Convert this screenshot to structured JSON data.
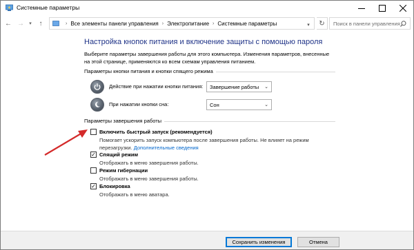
{
  "window": {
    "title": "Системные параметры"
  },
  "address": {
    "crumbs": [
      "Все элементы панели управления",
      "Электропитание",
      "Системные параметры"
    ],
    "search_placeholder": "Поиск в панели управления"
  },
  "main": {
    "heading": "Настройка кнопок питания и включение защиты с помощью пароля",
    "description": "Выберите параметры завершения работы для этого компьютера. Изменения параметров, внесенные на этой странице, применяются ко всем схемам управления питанием."
  },
  "power_buttons": {
    "group_label": "Параметры кнопки питания и кнопки спящего режима",
    "rows": [
      {
        "label": "Действие при нажатии кнопки питания:",
        "value": "Завершение работы"
      },
      {
        "label": "При нажатии кнопки сна:",
        "value": "Сон"
      }
    ]
  },
  "shutdown": {
    "group_label": "Параметры завершения работы",
    "options": [
      {
        "label": "Включить быстрый запуск (рекомендуется)",
        "checked": false,
        "desc": "Помогает ускорить запуск компьютера после завершения работы. Не влияет на режим перезагрузки.",
        "link": "Дополнительные сведения"
      },
      {
        "label": "Спящий режим",
        "checked": true,
        "desc": "Отображать в меню завершения работы."
      },
      {
        "label": "Режим гибернации",
        "checked": false,
        "desc": "Отображать в меню завершения работы."
      },
      {
        "label": "Блокировка",
        "checked": true,
        "desc": "Отображать в меню аватара."
      }
    ]
  },
  "footer": {
    "save_label": "Сохранить изменения",
    "cancel_label": "Отмена"
  },
  "colors": {
    "heading": "#1e3287",
    "link": "#0066cc",
    "arrow": "#d42a2a",
    "primary_border": "#0078d7"
  }
}
